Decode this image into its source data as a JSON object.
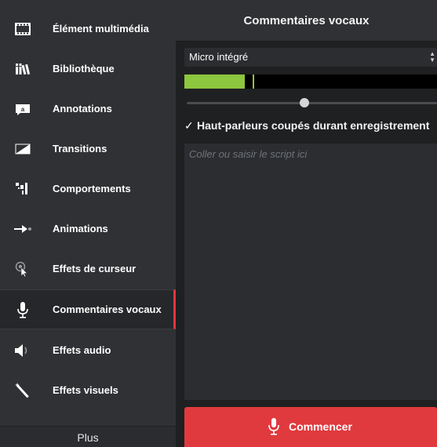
{
  "sidebar": {
    "items": [
      {
        "label": "Élément multimédia",
        "icon": "film-icon"
      },
      {
        "label": "Bibliothèque",
        "icon": "library-icon"
      },
      {
        "label": "Annotations",
        "icon": "annotation-icon"
      },
      {
        "label": "Transitions",
        "icon": "transition-icon"
      },
      {
        "label": "Comportements",
        "icon": "behaviors-icon"
      },
      {
        "label": "Animations",
        "icon": "animation-arrow-icon"
      },
      {
        "label": "Effets de curseur",
        "icon": "cursor-icon"
      },
      {
        "label": "Commentaires vocaux",
        "icon": "microphone-icon",
        "active": true
      },
      {
        "label": "Effets audio",
        "icon": "speaker-icon"
      },
      {
        "label": "Effets visuels",
        "icon": "magic-wand-icon"
      }
    ],
    "more_label": "Plus"
  },
  "panel": {
    "title": "Commentaires vocaux",
    "mic_source": "Micro intégré",
    "level": {
      "fill": 0.24,
      "peak": 0.27
    },
    "volume": 0.47,
    "mute_speakers_checked": true,
    "mute_speakers_label": "Haut-parleurs coupés durant enregistrement",
    "script_placeholder": "Coller ou saisir le script ici",
    "start_label": "Commencer"
  },
  "colors": {
    "accent_red": "#e03a3e",
    "level_green": "#8dc63f",
    "sidebar_bg": "#2f3134",
    "panel_bg": "#1f2022"
  }
}
